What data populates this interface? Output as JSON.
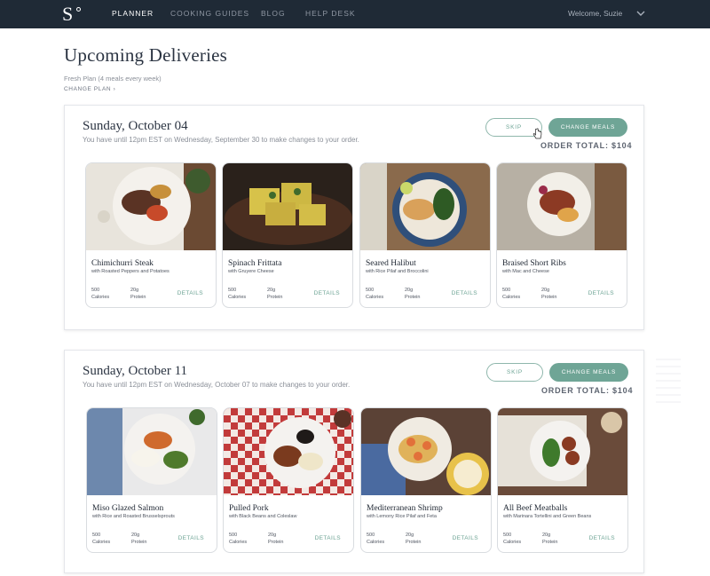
{
  "nav": {
    "logo": "S",
    "links": [
      "PLANNER",
      "COOKING GUIDES",
      "BLOG",
      "HELP DESK"
    ],
    "welcome": "Welcome, Suzie"
  },
  "header": {
    "title": "Upcoming Deliveries",
    "plan": "Fresh Plan (4 meals every week)",
    "change_plan": "CHANGE PLAN ›"
  },
  "deliveries": [
    {
      "date": "Sunday, October 04",
      "note": "You have until 12pm EST on Wednesday, September 30 to make changes to your order.",
      "skip_label": "SKIP",
      "change_label": "CHANGE MEALS",
      "order_total": "ORDER TOTAL: $104",
      "meals": [
        {
          "name": "Chimichurri Steak",
          "side": "with Roasted Peppers and Potatoes",
          "calories": "500",
          "calories_label": "Calories",
          "protein": "20g",
          "protein_label": "Protein",
          "details": "DETAILS"
        },
        {
          "name": "Spinach Frittata",
          "side": "with Gruyere Cheese",
          "calories": "500",
          "calories_label": "Calories",
          "protein": "20g",
          "protein_label": "Protein",
          "details": "DETAILS"
        },
        {
          "name": "Seared Halibut",
          "side": "with Rice Pilaf and Broccolini",
          "calories": "500",
          "calories_label": "Calories",
          "protein": "20g",
          "protein_label": "Protein",
          "details": "DETAILS"
        },
        {
          "name": "Braised Short Ribs",
          "side": "with Mac and Cheese",
          "calories": "500",
          "calories_label": "Calories",
          "protein": "20g",
          "protein_label": "Protein",
          "details": "DETAILS"
        }
      ]
    },
    {
      "date": "Sunday, October 11",
      "note": "You have until 12pm EST on Wednesday, October 07 to make changes to your order.",
      "skip_label": "SKIP",
      "change_label": "CHANGE MEALS",
      "order_total": "ORDER TOTAL: $104",
      "meals": [
        {
          "name": "Miso Glazed Salmon",
          "side": "with Rice and Roasted Brusselsprouts",
          "calories": "500",
          "calories_label": "Calories",
          "protein": "20g",
          "protein_label": "Protein",
          "details": "DETAILS"
        },
        {
          "name": "Pulled Pork",
          "side": "with Black Beans and Coleslaw",
          "calories": "500",
          "calories_label": "Calories",
          "protein": "20g",
          "protein_label": "Protein",
          "details": "DETAILS"
        },
        {
          "name": "Mediterranean Shrimp",
          "side": "with Lemony Rice Pilaf and Feta",
          "calories": "500",
          "calories_label": "Calories",
          "protein": "20g",
          "protein_label": "Protein",
          "details": "DETAILS"
        },
        {
          "name": "All Beef Meatballs",
          "side": "with Marinara Tortellini and Green Beans",
          "calories": "500",
          "calories_label": "Calories",
          "protein": "20g",
          "protein_label": "Protein",
          "details": "DETAILS"
        }
      ]
    }
  ],
  "colors": {
    "nav_bg": "#1f2a36",
    "accent": "#6fa596",
    "text_dark": "#2b3442",
    "text_muted": "#8a8f98"
  }
}
